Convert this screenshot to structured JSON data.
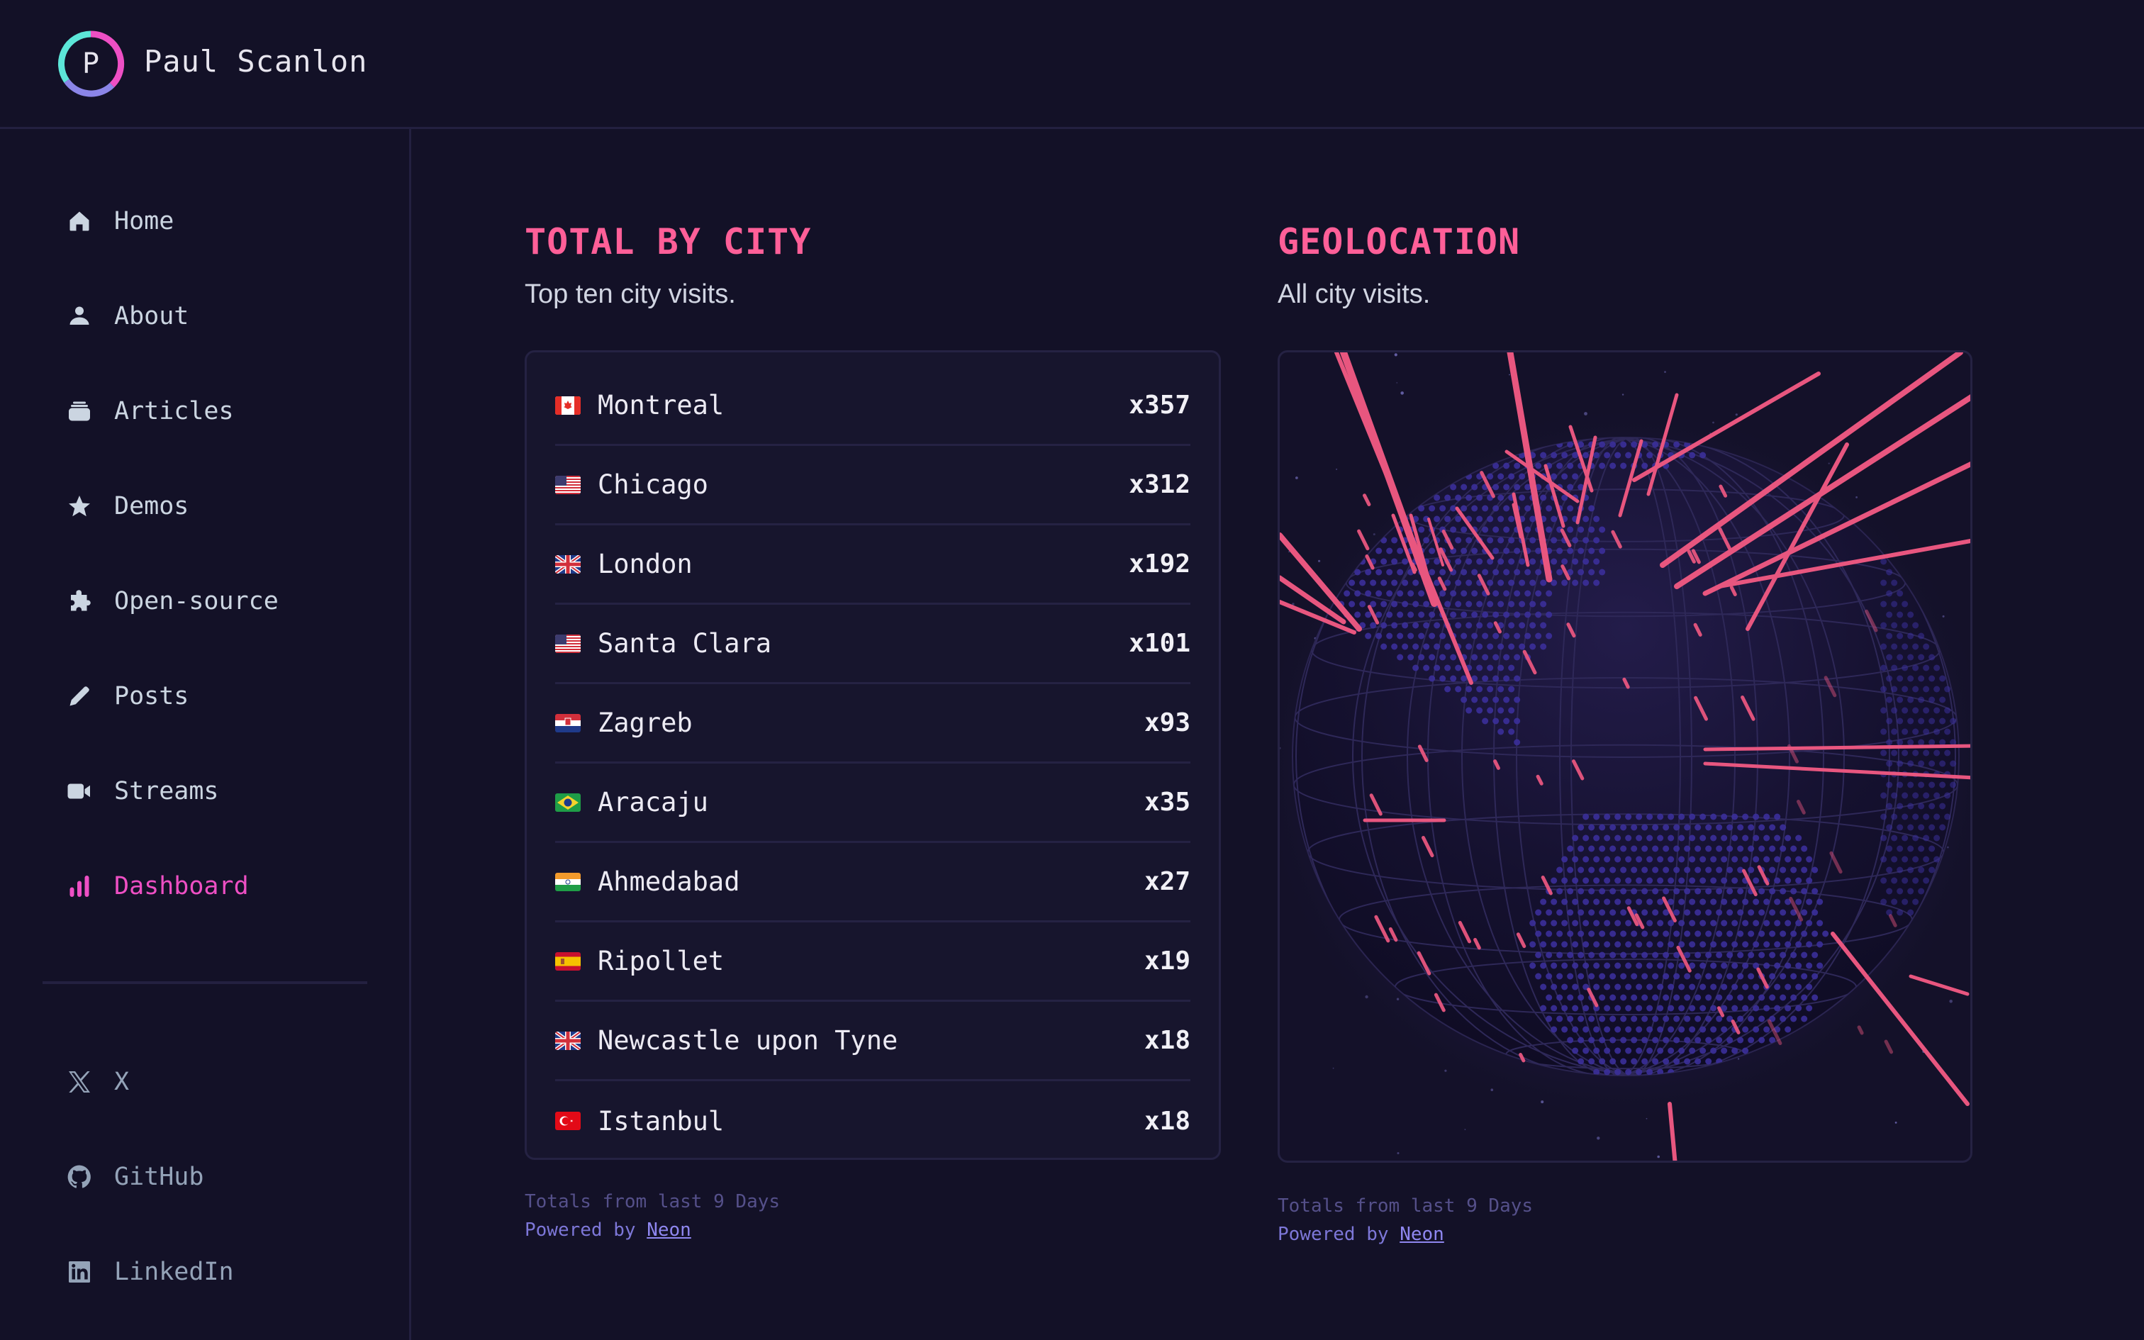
{
  "header": {
    "logo_letter": "P",
    "site_name": "Paul Scanlon",
    "logo_colors": [
      "#ee4fc4",
      "#8b85e8",
      "#5ce6d8"
    ]
  },
  "sidebar": {
    "nav": [
      {
        "label": "Home",
        "icon": "home-icon",
        "active": false
      },
      {
        "label": "About",
        "icon": "user-icon",
        "active": false
      },
      {
        "label": "Articles",
        "icon": "stack-icon",
        "active": false
      },
      {
        "label": "Demos",
        "icon": "star-icon",
        "active": false
      },
      {
        "label": "Open-source",
        "icon": "puzzle-icon",
        "active": false
      },
      {
        "label": "Posts",
        "icon": "pencil-icon",
        "active": false
      },
      {
        "label": "Streams",
        "icon": "video-icon",
        "active": false
      },
      {
        "label": "Dashboard",
        "icon": "bar-chart-icon",
        "active": true
      }
    ],
    "socials": [
      {
        "label": "X",
        "icon": "x-logo-icon"
      },
      {
        "label": "GitHub",
        "icon": "github-icon"
      },
      {
        "label": "LinkedIn",
        "icon": "linkedin-icon"
      }
    ],
    "active_color": "#ee4fc4"
  },
  "total_by_city": {
    "title": "TOTAL BY CITY",
    "subtitle": "Top ten city visits.",
    "rows": [
      {
        "flag": "CA",
        "city": "Montreal",
        "count": "x357"
      },
      {
        "flag": "US",
        "city": "Chicago",
        "count": "x312"
      },
      {
        "flag": "GB",
        "city": "London",
        "count": "x192"
      },
      {
        "flag": "US",
        "city": "Santa Clara",
        "count": "x101"
      },
      {
        "flag": "HR",
        "city": "Zagreb",
        "count": "x93"
      },
      {
        "flag": "BR",
        "city": "Aracaju",
        "count": "x35"
      },
      {
        "flag": "IN",
        "city": "Ahmedabad",
        "count": "x27"
      },
      {
        "flag": "ES",
        "city": "Ripollet",
        "count": "x19"
      },
      {
        "flag": "GB",
        "city": "Newcastle upon Tyne",
        "count": "x18"
      },
      {
        "flag": "TR",
        "city": "Istanbul",
        "count": "x18"
      }
    ],
    "footnote": "Totals from last 9 Days",
    "powered_prefix": "Powered by ",
    "powered_link": "Neon"
  },
  "geolocation": {
    "title": "GEOLOCATION",
    "subtitle": "All city visits.",
    "footnote": "Totals from last 9 Days",
    "powered_prefix": "Powered by ",
    "powered_link": "Neon",
    "bar_color": "#e8567f",
    "land_dot_color": "#3b2f9a"
  }
}
